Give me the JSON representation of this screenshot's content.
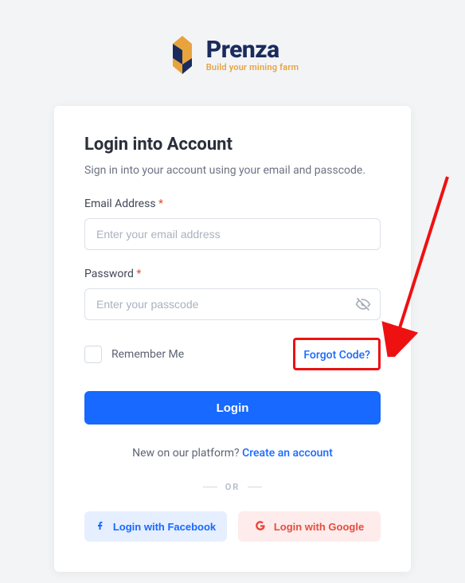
{
  "brand": {
    "name": "Prenza",
    "tagline": "Build your mining farm"
  },
  "card": {
    "title": "Login into Account",
    "subtitle": "Sign in into your account using your email and passcode."
  },
  "email": {
    "label": "Email Address",
    "placeholder": "Enter your email address"
  },
  "password": {
    "label": "Password",
    "placeholder": "Enter your passcode"
  },
  "remember_label": "Remember Me",
  "forgot_label": "Forgot Code?",
  "login_label": "Login",
  "newuser": {
    "prefix": "New on our platform? ",
    "link": "Create an account"
  },
  "divider_label": "OR",
  "social": {
    "facebook": "Login with Facebook",
    "google": "Login with Google"
  },
  "required_mark": "*"
}
